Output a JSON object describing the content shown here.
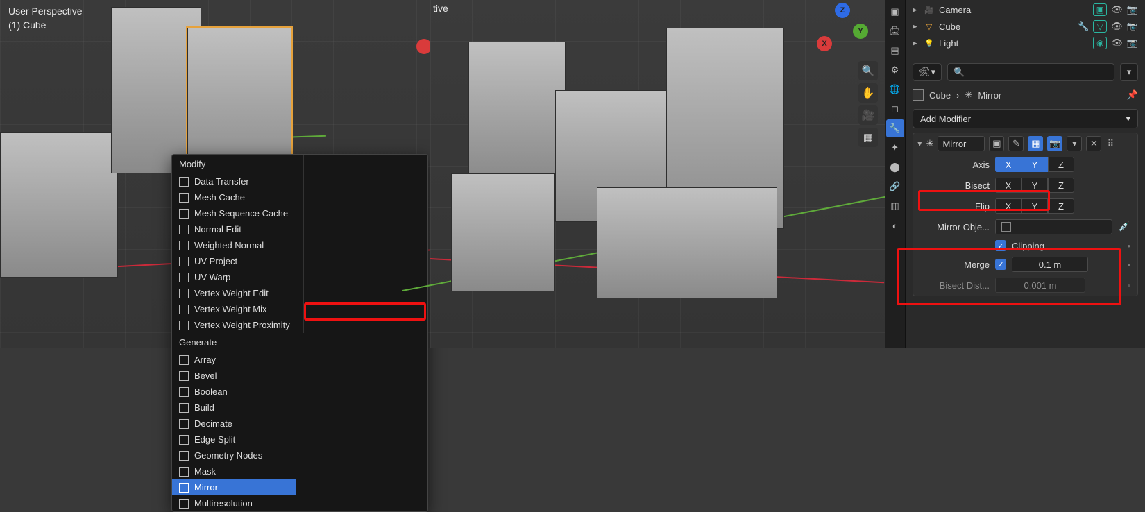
{
  "viewports": {
    "left": {
      "title": "User Perspective",
      "subtitle": "(1) Cube"
    },
    "right": {
      "title_cut": "tive"
    }
  },
  "nav_gizmo": {
    "x": "X",
    "y": "Y",
    "z": "Z"
  },
  "menu": {
    "modify_header": "Modify",
    "generate_header": "Generate",
    "modify": [
      "Data Transfer",
      "Mesh Cache",
      "Mesh Sequence Cache",
      "Normal Edit",
      "Weighted Normal",
      "UV Project",
      "UV Warp",
      "Vertex Weight Edit",
      "Vertex Weight Mix",
      "Vertex Weight Proximity"
    ],
    "generate": [
      "Array",
      "Bevel",
      "Boolean",
      "Build",
      "Decimate",
      "Edge Split",
      "Geometry Nodes",
      "Mask",
      "Mirror",
      "Multiresolution"
    ],
    "selected": "Mirror"
  },
  "outliner": {
    "items": [
      {
        "icon": "🎥",
        "icon_color": "#e6a23c",
        "name": "Camera"
      },
      {
        "icon": "▽",
        "icon_color": "#e6a23c",
        "name": "Cube"
      },
      {
        "icon": "💡",
        "icon_color": "#e6a23c",
        "name": "Light"
      }
    ]
  },
  "search": {
    "placeholder": ""
  },
  "breadcrumb": {
    "obj": "Cube",
    "mod": "Mirror"
  },
  "add_modifier": {
    "label": "Add Modifier"
  },
  "modifier": {
    "name": "Mirror",
    "axis_label": "Axis",
    "bisect_label": "Bisect",
    "flip_label": "Flip",
    "axes": [
      "X",
      "Y",
      "Z"
    ],
    "axis_on": [
      "X",
      "Y"
    ],
    "mirror_obj_label": "Mirror Obje...",
    "clipping_label": "Clipping",
    "merge_label": "Merge",
    "merge_value": "0.1 m",
    "bisect_dist_label": "Bisect Dist...",
    "bisect_dist_value": "0.001 m"
  }
}
